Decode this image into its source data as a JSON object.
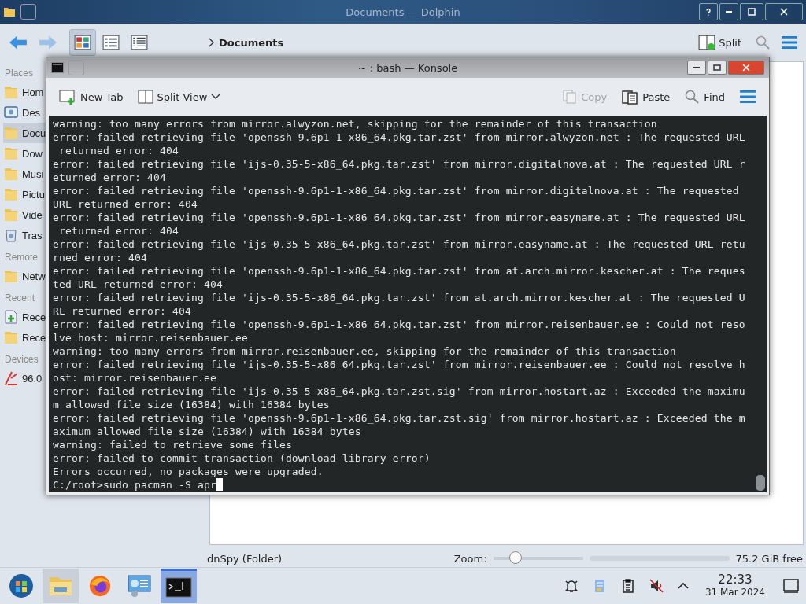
{
  "dolphin": {
    "title": "Documents — Dolphin",
    "toolbar": {
      "back": {
        "disabled": false
      },
      "forward": {
        "disabled": true
      },
      "view_modes": [
        {
          "kind": "icons",
          "selected": true
        },
        {
          "kind": "compact",
          "selected": false
        },
        {
          "kind": "details",
          "selected": false
        }
      ],
      "breadcrumb": "Documents",
      "split": "Split"
    },
    "sidebar": [
      {
        "heading": "Places",
        "items": [
          {
            "label": "Hom",
            "kind": "folder",
            "selected": false
          },
          {
            "label": "Des",
            "kind": "desktop",
            "selected": false
          },
          {
            "label": "Docu",
            "kind": "folder",
            "selected": true
          },
          {
            "label": "Dow",
            "kind": "folder",
            "selected": false
          },
          {
            "label": "Musi",
            "kind": "folder",
            "selected": false
          },
          {
            "label": "Pictu",
            "kind": "folder",
            "selected": false
          },
          {
            "label": "Vide",
            "kind": "folder",
            "selected": false
          },
          {
            "label": "Tras",
            "kind": "trash",
            "selected": false
          }
        ]
      },
      {
        "heading": "Remote",
        "items": [
          {
            "label": "Netw",
            "kind": "folder",
            "selected": false
          }
        ]
      },
      {
        "heading": "Recent",
        "items": [
          {
            "label": "Rece",
            "kind": "document",
            "selected": false
          },
          {
            "label": "Rece",
            "kind": "folder",
            "selected": false
          }
        ]
      },
      {
        "heading": "Devices",
        "items": [
          {
            "label": "96.0",
            "kind": "drive",
            "selected": false
          }
        ]
      }
    ],
    "status_bar": {
      "text": "dnSpy (Folder)",
      "zoom_label": "Zoom:",
      "zoom": {
        "level": 0.2
      },
      "free_space": "75.2 GiB free"
    }
  },
  "konsole": {
    "title": "~ : bash — Konsole",
    "toolbar": {
      "new_tab": "New Tab",
      "split_view": "Split View",
      "copy": {
        "label": "Copy",
        "disabled": true
      },
      "paste": "Paste",
      "find": "Find"
    },
    "lines": [
      "warning: too many errors from mirror.alwyzon.net, skipping for the remainder of this transaction",
      "error: failed retrieving file 'openssh-9.6p1-1-x86_64.pkg.tar.zst' from mirror.alwyzon.net : The requested URL",
      " returned error: 404",
      "error: failed retrieving file 'ijs-0.35-5-x86_64.pkg.tar.zst' from mirror.digitalnova.at : The requested URL r",
      "eturned error: 404",
      "error: failed retrieving file 'openssh-9.6p1-1-x86_64.pkg.tar.zst' from mirror.digitalnova.at : The requested",
      "URL returned error: 404",
      "error: failed retrieving file 'openssh-9.6p1-1-x86_64.pkg.tar.zst' from mirror.easyname.at : The requested URL",
      " returned error: 404",
      "error: failed retrieving file 'ijs-0.35-5-x86_64.pkg.tar.zst' from mirror.easyname.at : The requested URL retu",
      "rned error: 404",
      "error: failed retrieving file 'openssh-9.6p1-1-x86_64.pkg.tar.zst' from at.arch.mirror.kescher.at : The reques",
      "ted URL returned error: 404",
      "error: failed retrieving file 'ijs-0.35-5-x86_64.pkg.tar.zst' from at.arch.mirror.kescher.at : The requested U",
      "RL returned error: 404",
      "error: failed retrieving file 'openssh-9.6p1-1-x86_64.pkg.tar.zst' from mirror.reisenbauer.ee : Could not reso",
      "lve host: mirror.reisenbauer.ee",
      "warning: too many errors from mirror.reisenbauer.ee, skipping for the remainder of this transaction",
      "error: failed retrieving file 'ijs-0.35-5-x86_64.pkg.tar.zst' from mirror.reisenbauer.ee : Could not resolve h",
      "ost: mirror.reisenbauer.ee",
      "error: failed retrieving file 'ijs-0.35-5-x86_64.pkg.tar.zst.sig' from mirror.hostart.az : Exceeded the maximu",
      "m allowed file size (16384) with 16384 bytes",
      "error: failed retrieving file 'openssh-9.6p1-1-x86_64.pkg.tar.zst.sig' from mirror.hostart.az : Exceeded the m",
      "aximum allowed file size (16384) with 16384 bytes",
      "warning: failed to retrieve some files",
      "error: failed to commit transaction (download library error)",
      "Errors occurred, no packages were upgraded."
    ],
    "prompt": "C:/root>sudo pacman -S apr"
  },
  "taskbar": {
    "items": [
      {
        "kind": "start",
        "selected": false
      },
      {
        "kind": "files",
        "selected": false
      },
      {
        "kind": "browser",
        "selected": false
      },
      {
        "kind": "remote",
        "selected": false
      },
      {
        "kind": "terminal",
        "selected": true
      }
    ],
    "tray": [
      {
        "kind": "bell"
      },
      {
        "kind": "notes"
      },
      {
        "kind": "clipboard"
      },
      {
        "kind": "muted"
      },
      {
        "kind": "expand"
      }
    ],
    "time": "22:33",
    "date": "31 Mar 2024"
  }
}
